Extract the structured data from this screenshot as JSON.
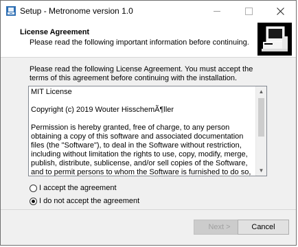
{
  "window": {
    "title": "Setup - Metronome version 1.0"
  },
  "header": {
    "title": "License Agreement",
    "subtitle": "Please read the following important information before continuing."
  },
  "intro": "Please read the following License Agreement. You must accept the terms of this agreement before continuing with the installation.",
  "license": {
    "paragraphs": [
      "MIT License",
      "Copyright (c) 2019 Wouter HisschemÃ¶ller",
      "Permission is hereby granted, free of charge, to any person obtaining a copy of this software and associated documentation files (the \"Software\"), to deal in the Software without restriction, including without limitation the rights to use, copy, modify, merge, publish, distribute, sublicense, and/or sell copies of the Software, and to permit persons to whom the Software is furnished to do so, subject to the following conditions:"
    ]
  },
  "options": {
    "accept_label": "I accept the agreement",
    "decline_label": "I do not accept the agreement",
    "selected": "decline"
  },
  "buttons": {
    "next_label": "Next >",
    "cancel_label": "Cancel"
  },
  "icons": {
    "app": "setup-app-icon",
    "minimize": "minimize-icon",
    "maximize": "maximize-icon",
    "close": "close-icon",
    "scroll_up": "scroll-up-icon",
    "scroll_down": "scroll-down-icon",
    "wizard_image": "computer-installer-icon"
  }
}
